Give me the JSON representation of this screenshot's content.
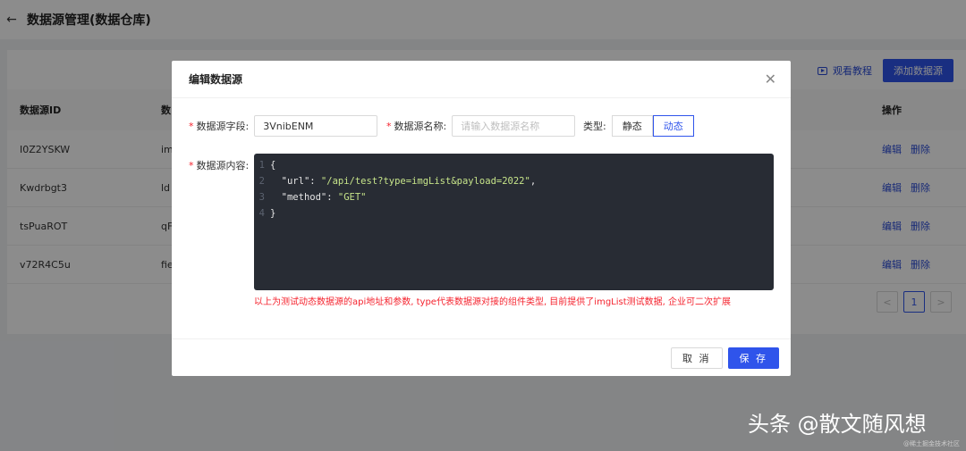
{
  "header": {
    "title": "数据源管理(数据仓库)"
  },
  "toolbar": {
    "tutorial_label": "观看教程",
    "add_label": "添加数据源"
  },
  "table": {
    "columns": {
      "id": "数据源ID",
      "name": "数",
      "op": "操作"
    },
    "rows": [
      {
        "id": "I0Z2YSKW",
        "name": "im"
      },
      {
        "id": "Kwdrbgt3",
        "name": "ld"
      },
      {
        "id": "tsPuaROT",
        "name": "qF"
      },
      {
        "id": "v72R4C5u",
        "name": "fie"
      }
    ],
    "op_edit": "编辑",
    "op_delete": "删除"
  },
  "pagination": {
    "prev": "<",
    "current": "1",
    "next": ">"
  },
  "modal": {
    "title": "编辑数据源",
    "field_key_label": "数据源字段:",
    "field_key_value": "3VnibENM",
    "field_name_label": "数据源名称:",
    "field_name_placeholder": "请输入数据源名称",
    "type_label": "类型:",
    "type_static": "静态",
    "type_dynamic": "动态",
    "content_label": "数据源内容:",
    "code": {
      "line1": "{",
      "line2_key": "\"url\"",
      "line2_value": "\"/api/test?type=imgList&payload=2022\"",
      "line3_key": "\"method\"",
      "line3_value": "\"GET\"",
      "line4": "}"
    },
    "hint": "以上为测试动态数据源的api地址和参数, type代表数据源对接的组件类型, 目前提供了imgList测试数据, 企业可二次扩展",
    "cancel_label": "取 消",
    "save_label": "保 存"
  },
  "watermark": {
    "text": "头条 @散文随风想",
    "small": "@稀土掘金技术社区"
  },
  "colors": {
    "primary": "#2f54eb",
    "danger": "#f5222d",
    "editor_bg": "#282c34",
    "string": "#c7e58a"
  },
  "icons": {
    "back": "arrow-left-icon",
    "close": "close-icon",
    "tutorial": "play-icon"
  }
}
